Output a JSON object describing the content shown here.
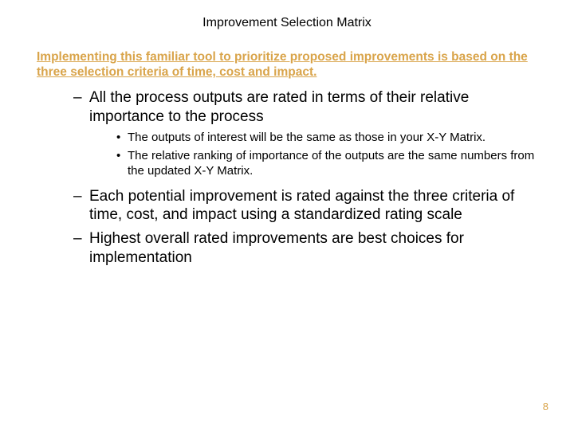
{
  "title": "Improvement Selection Matrix",
  "subtitle": "Implementing this familiar tool to prioritize proposed improvements is based on the three selection criteria of time, cost and impact.",
  "bullets": {
    "b1": "All the process outputs are rated in terms of their relative importance to the process",
    "b1_sub1": "The outputs of interest will be the same as those in your X-Y Matrix.",
    "b1_sub2": "The relative ranking of importance of the outputs are the same numbers from the updated X-Y Matrix.",
    "b2": "Each potential improvement is rated against the three criteria  of time, cost, and impact using a standardized rating scale",
    "b3": "Highest overall rated improvements are best choices for implementation"
  },
  "page_number": "8"
}
